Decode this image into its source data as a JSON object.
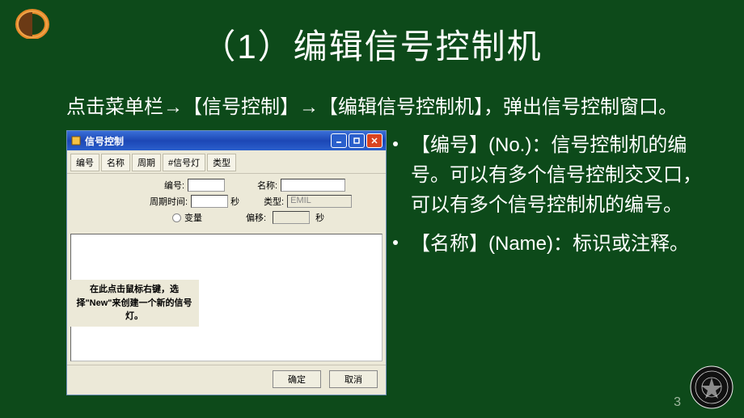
{
  "slide": {
    "title": "（1）编辑信号控制机",
    "intro": "点击菜单栏→【信号控制】→【编辑信号控制机】，弹出信号控制窗口。",
    "page_number": "3"
  },
  "window": {
    "title": "信号控制",
    "toolbar": [
      "编号",
      "名称",
      "周期",
      "#信号灯",
      "类型"
    ],
    "fields": {
      "no_label": "编号:",
      "name_label": "名称:",
      "cycle_label": "周期时间:",
      "cycle_unit": "秒",
      "type_label": "类型:",
      "type_value": "EMIL",
      "offset_radio": "变量",
      "offset_label": "偏移:",
      "offset_unit": "秒"
    },
    "hint": "在此点击鼠标右键，选择\"New\"来创建一个新的信号灯。",
    "ok": "确定",
    "cancel": "取消"
  },
  "notes": {
    "item1": "【编号】(No.)：信号控制机的编号。可以有多个信号控制交叉口，可以有多个信号控制机的编号。",
    "item2": "【名称】(Name)：标识或注释。"
  }
}
